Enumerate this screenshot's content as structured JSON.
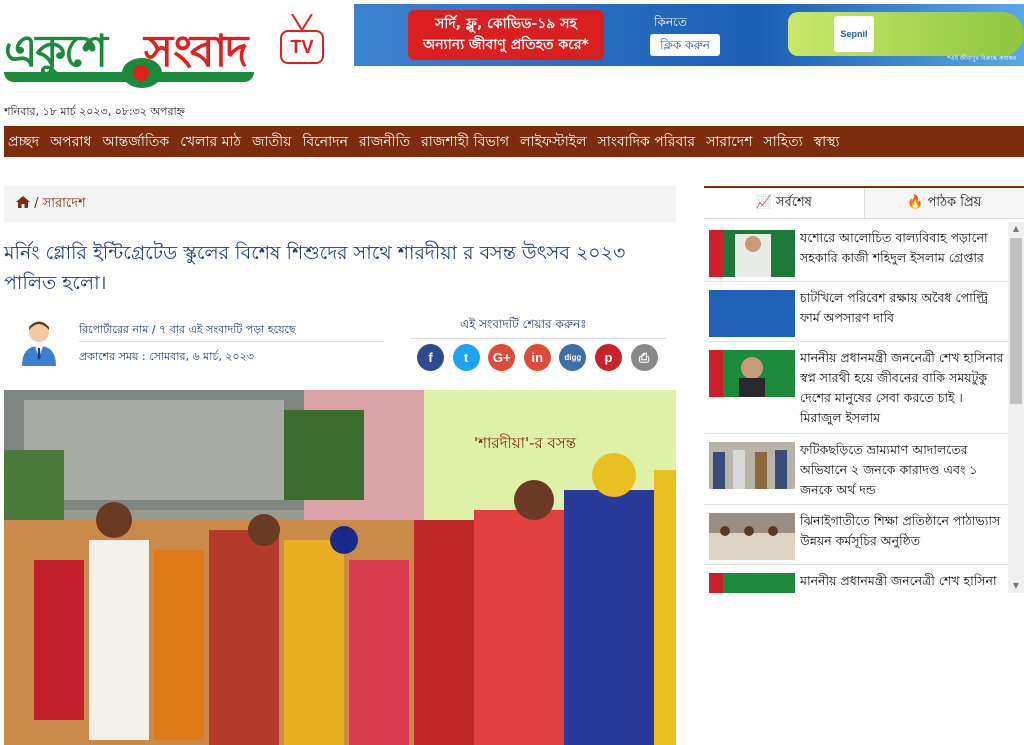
{
  "logo": {
    "part1": "একুশে",
    "part2": "সংবাদ",
    "tv": "TV"
  },
  "ad": {
    "headline_line1": "সর্দি, ফ্লু, কোভিড-১৯ সহ",
    "headline_line2": "অন্যান্য জীবাণু প্রতিহত করে*",
    "cta_top": "কিনতে",
    "cta": "ক্লিক করুন",
    "brand": "Sepnil",
    "fine": "*এই জীবাণুর বিরুদ্ধে কার্যকর"
  },
  "date": "শনিবার, ১৮ মার্চ ২০২৩, ০৮:৩২ অপরাহ্ন",
  "nav": [
    "প্রচ্ছদ",
    "অপরাধ",
    "আন্তর্জাতিক",
    "খেলার মাঠ",
    "জাতীয়",
    "বিনোদন",
    "রাজনীতি",
    "রাজশাহী বিভাগ",
    "লাইফস্টাইল",
    "সাংবাদিক পরিবার",
    "সারাদেশ",
    "সাহিত্য",
    "স্বাস্থ্য"
  ],
  "breadcrumb": {
    "section": " / সারাদেশ"
  },
  "article": {
    "headline": "মর্নিং গ্লোরি ইন্টিগ্রেটেড স্কুলের বিশেষ শিশুদের সাথে শারদীয়া র বসন্ত উৎসব ২০২৩ পালিত হলো।",
    "reporter": "রিপোর্টারের নাম / ৭ বার এই সংবাদটি পড়া হয়েছে",
    "published": "প্রকাশের সময় : সোমবার, ৬ মার্চ, ২০২৩",
    "share_title": "এই সংবাদটি শেয়ার করুনঃ",
    "photo_banner": "'শারদীয়া'-র বসন্ত"
  },
  "share_buttons": [
    {
      "icon": "facebook-icon",
      "glyph": "f",
      "color": "#2d4b8e"
    },
    {
      "icon": "twitter-icon",
      "glyph": "t",
      "color": "#1da1f2"
    },
    {
      "icon": "google-plus-icon",
      "glyph": "G+",
      "color": "#dd4b39"
    },
    {
      "icon": "linkedin-icon",
      "glyph": "in",
      "color": "#dd4b39"
    },
    {
      "icon": "digg-icon",
      "glyph": "digg",
      "color": "#3e6ea8"
    },
    {
      "icon": "pinterest-icon",
      "glyph": "p",
      "color": "#c8232c"
    },
    {
      "icon": "print-icon",
      "glyph": "⎙",
      "color": "#888888"
    }
  ],
  "sidebar": {
    "tab_latest": "সর্বশেষ",
    "tab_popular": "পাঠক প্রিয়",
    "items": [
      {
        "title": "যশোরে আলোচিত বাল্যবিবাহ পড়ানো সহকারি কাজী শহিদুল ইসলাম গ্রেপ্তার"
      },
      {
        "title": "চাটখিলে পরিবেশ রক্ষায় অবৈধ পোল্ট্রি ফার্ম অপসারণ দাবি",
        "thumb_text": "চাটখিলে পরিবেশ রক্ষায় অবৈধ পোল্ট্রি ফার্ম অপসারণ দাবি"
      },
      {
        "title": "মাননীয় প্রধানমন্ত্রী জননেত্রী শেখ হাসিনার স্বপ্ন সারথী হয়ে জীবনের বাকি সময়টুকু দেশের মানুষের সেবা করতে চাই । মিরাজুল ইসলাম"
      },
      {
        "title": "ফটিকছড়িতে ভ্রাম্যমাণ আদালতের অভিযানে ২ জনকে কারাদণ্ড এবং ১ জনকে অর্থ দন্ড"
      },
      {
        "title": "ঝিনাইগাতীতে শিক্ষা প্রতিষ্ঠানে পাঠাভ্যাস উন্নয়ন কর্মসূচির অনুষ্ঠিত"
      },
      {
        "title": "মাননীয় প্রধানমন্ত্রী জননেত্রী শেখ হাসিনা"
      }
    ]
  }
}
